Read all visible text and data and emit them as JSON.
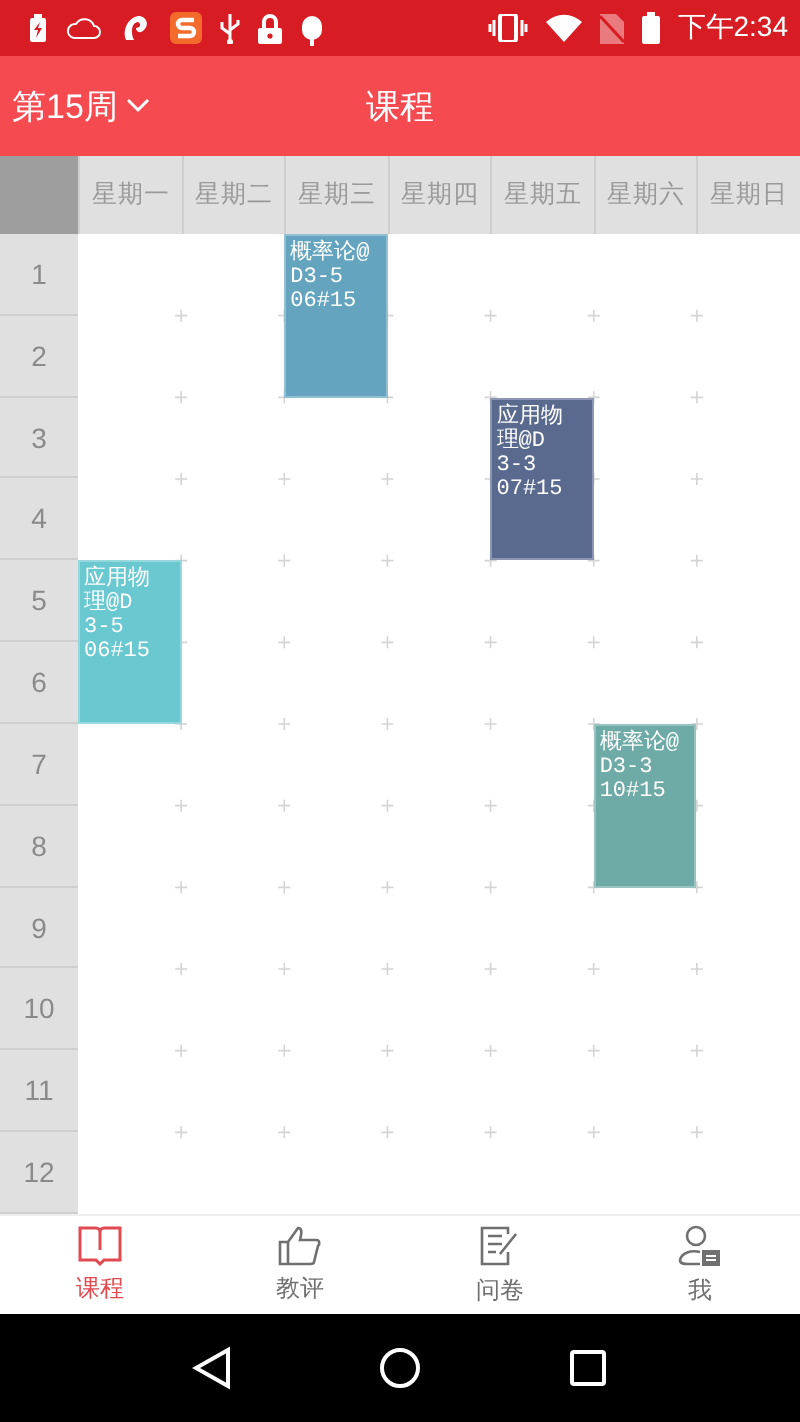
{
  "status_bar": {
    "time": "下午2:34"
  },
  "header": {
    "week": "第15周",
    "title": "课程"
  },
  "periods": [
    "1",
    "2",
    "3",
    "4",
    "5",
    "6",
    "7",
    "8",
    "9",
    "10",
    "11",
    "12"
  ],
  "days": [
    {
      "label": "星期一",
      "slots": [
        {
          "kind": "empty"
        },
        {
          "kind": "empty"
        },
        {
          "kind": "course",
          "text": "应用物理@D\n3-5\n06#15",
          "color": "#6ac8d0"
        },
        {
          "kind": "empty"
        },
        {
          "kind": "empty"
        },
        {
          "kind": "empty"
        }
      ]
    },
    {
      "label": "星期二",
      "slots": [
        {
          "kind": "empty"
        },
        {
          "kind": "empty"
        },
        {
          "kind": "empty"
        },
        {
          "kind": "empty"
        },
        {
          "kind": "empty"
        },
        {
          "kind": "empty"
        }
      ]
    },
    {
      "label": "星期三",
      "slots": [
        {
          "kind": "course",
          "text": "概率论@D3-5\n06#15",
          "color": "#64a4bf"
        },
        {
          "kind": "empty"
        },
        {
          "kind": "empty"
        },
        {
          "kind": "empty"
        },
        {
          "kind": "empty"
        },
        {
          "kind": "empty"
        }
      ]
    },
    {
      "label": "星期四",
      "slots": [
        {
          "kind": "empty"
        },
        {
          "kind": "empty"
        },
        {
          "kind": "empty"
        },
        {
          "kind": "empty"
        },
        {
          "kind": "empty"
        },
        {
          "kind": "empty"
        }
      ]
    },
    {
      "label": "星期五",
      "slots": [
        {
          "kind": "empty"
        },
        {
          "kind": "course",
          "text": "应用物理@D\n3-3\n07#15",
          "color": "#5a6a8e"
        },
        {
          "kind": "empty"
        },
        {
          "kind": "empty"
        },
        {
          "kind": "empty"
        },
        {
          "kind": "empty"
        }
      ]
    },
    {
      "label": "星期六",
      "slots": [
        {
          "kind": "empty"
        },
        {
          "kind": "empty"
        },
        {
          "kind": "empty"
        },
        {
          "kind": "course",
          "text": "概率论@D3-3\n10#15",
          "color": "#6eaaa6"
        },
        {
          "kind": "empty"
        },
        {
          "kind": "empty"
        }
      ]
    },
    {
      "label": "星期日",
      "slots": [
        {
          "kind": "empty"
        },
        {
          "kind": "empty"
        },
        {
          "kind": "empty"
        },
        {
          "kind": "empty"
        },
        {
          "kind": "empty"
        },
        {
          "kind": "empty"
        }
      ]
    }
  ],
  "tabs": [
    {
      "label": "课程",
      "kind": "book",
      "selected": true
    },
    {
      "label": "教评",
      "kind": "thumb",
      "selected": false
    },
    {
      "label": "问卷",
      "kind": "form",
      "selected": false
    },
    {
      "label": "我",
      "kind": "user",
      "selected": false
    }
  ]
}
